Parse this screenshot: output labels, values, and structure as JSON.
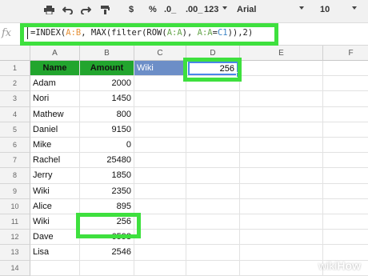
{
  "toolbar": {
    "icons": [
      "print-icon",
      "undo-icon",
      "redo-icon",
      "paint-format-icon"
    ],
    "currency": "$",
    "percent": "%",
    "decimal_dec": ".0_",
    "decimal_inc": ".00_",
    "number_format": "123",
    "font": "Arial",
    "font_size": "10"
  },
  "formula_bar": {
    "fx_label": "fx",
    "formula_parts": [
      {
        "text": "=INDEX(",
        "color": "#222222"
      },
      {
        "text": "A:B",
        "color": "#e69138"
      },
      {
        "text": ", MAX(filter(ROW(",
        "color": "#222222"
      },
      {
        "text": "A:A",
        "color": "#6aa84f"
      },
      {
        "text": "), ",
        "color": "#222222"
      },
      {
        "text": "A:A",
        "color": "#6aa84f"
      },
      {
        "text": "=",
        "color": "#222222"
      },
      {
        "text": "C1",
        "color": "#3d85c6"
      },
      {
        "text": ")),2)",
        "color": "#222222"
      }
    ]
  },
  "columns": [
    "A",
    "B",
    "C",
    "D",
    "E",
    "F"
  ],
  "rows": [
    "1",
    "2",
    "3",
    "4",
    "5",
    "6",
    "7",
    "8",
    "9",
    "10",
    "11",
    "12",
    "13",
    "14"
  ],
  "header_row": {
    "name": "Name",
    "amount": "Amount",
    "lookup": "Wiki",
    "result": "256"
  },
  "data_rows": [
    {
      "name": "Adam",
      "amount": "2000"
    },
    {
      "name": "Nori",
      "amount": "1450"
    },
    {
      "name": "Mathew",
      "amount": "800"
    },
    {
      "name": "Daniel",
      "amount": "9150"
    },
    {
      "name": "Mike",
      "amount": "0"
    },
    {
      "name": "Rachel",
      "amount": "25480"
    },
    {
      "name": "Jerry",
      "amount": "1850"
    },
    {
      "name": "Wiki",
      "amount": "2350"
    },
    {
      "name": "Alice",
      "amount": "895"
    },
    {
      "name": "Wiki",
      "amount": "256"
    },
    {
      "name": "Dave",
      "amount": "6598"
    },
    {
      "name": "Lisa",
      "amount": "2546"
    }
  ],
  "colors": {
    "highlight": "#3ee03e",
    "header_green": "#22a52e",
    "header_blue": "#6c8ec7",
    "selection": "#4a86e8"
  },
  "watermark": {
    "wiki": "wiki",
    "how": "How"
  }
}
